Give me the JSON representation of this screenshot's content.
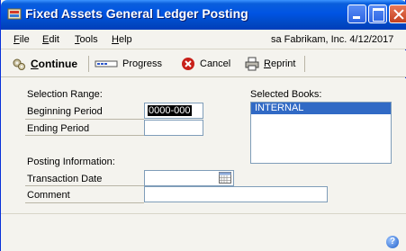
{
  "window": {
    "title": "Fixed Assets General Ledger Posting"
  },
  "menu": {
    "items": [
      {
        "label_first": "F",
        "label_rest": "ile"
      },
      {
        "label_first": "E",
        "label_rest": "dit"
      },
      {
        "label_first": "T",
        "label_rest": "ools"
      },
      {
        "label_first": "H",
        "label_rest": "elp"
      }
    ],
    "company_info": "sa  Fabrikam, Inc. 4/12/2017"
  },
  "toolbar": {
    "continue": {
      "label_first": "C",
      "label_rest": "ontinue"
    },
    "progress": {
      "label": "Progress"
    },
    "cancel": {
      "label": "Cancel"
    },
    "reprint": {
      "label_first": "R",
      "label_rest": "eprint"
    }
  },
  "form": {
    "selection_range_label": "Selection Range:",
    "beginning_period_label": "Beginning Period",
    "beginning_period_value": "0000-000",
    "ending_period_label": "Ending Period",
    "ending_period_value": "",
    "posting_info_label": "Posting Information:",
    "transaction_date_label": "Transaction Date",
    "transaction_date_value": "",
    "comment_label": "Comment",
    "comment_value": "",
    "selected_books_label": "Selected Books:",
    "selected_books": [
      "INTERNAL"
    ]
  },
  "icons": {
    "app": "fixed-assets-app-icon",
    "continue": "gears-icon",
    "progress": "progress-bar-icon",
    "cancel": "cancel-x-icon",
    "reprint": "printer-icon",
    "calendar": "calendar-icon",
    "help": "help-icon"
  },
  "colors": {
    "titlebar": "#0054e3",
    "selection": "#316ac5",
    "cancel_red": "#c8201a"
  }
}
